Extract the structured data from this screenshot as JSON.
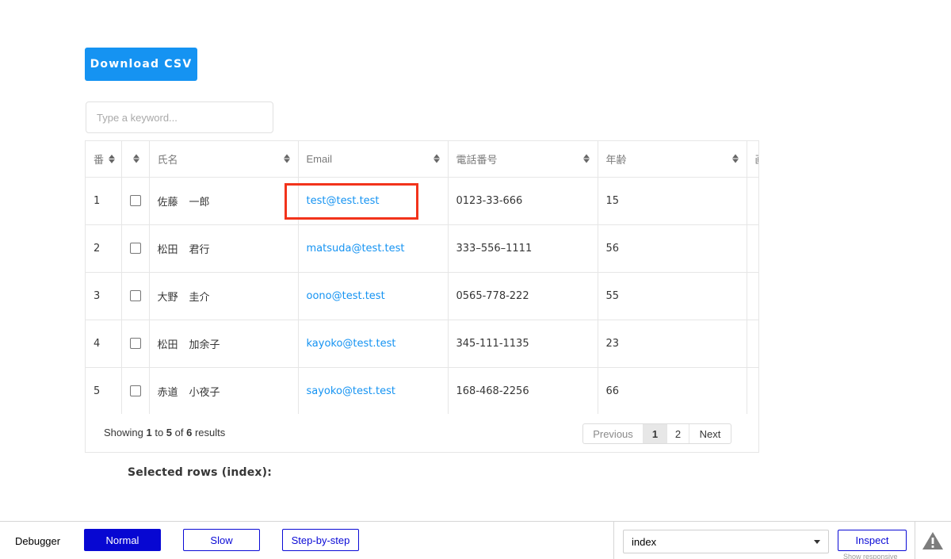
{
  "toolbar": {
    "download_label": "Download CSV"
  },
  "search": {
    "placeholder": "Type a keyword..."
  },
  "table": {
    "headers": {
      "index": "番",
      "checkbox": "",
      "name": "氏名",
      "email": "Email",
      "phone": "電話番号",
      "age": "年齢",
      "cut": "画"
    },
    "rows": [
      {
        "index": "1",
        "last": "佐藤",
        "first": "一郎",
        "email": "test@test.test",
        "phone": "0123-33-666",
        "age": "15"
      },
      {
        "index": "2",
        "last": "松田",
        "first": "君行",
        "email": "matsuda@test.test",
        "phone": "333–556–1111",
        "age": "56"
      },
      {
        "index": "3",
        "last": "大野",
        "first": "圭介",
        "email": "oono@test.test",
        "phone": "0565-778-222",
        "age": "55"
      },
      {
        "index": "4",
        "last": "松田",
        "first": "加余子",
        "email": "kayoko@test.test",
        "phone": "345-111-1135",
        "age": "23"
      },
      {
        "index": "5",
        "last": "赤道",
        "first": "小夜子",
        "email": "sayoko@test.test",
        "phone": "168-468-2256",
        "age": "66"
      }
    ],
    "image_peek_colors": [
      "#e8a87c",
      "#e8b07c",
      "#d9826a",
      "#b36a4f",
      "#c4846a"
    ]
  },
  "footer": {
    "showing_prefix": "Showing ",
    "from": "1",
    "to_word": " to ",
    "to": "5",
    "of_word": " of ",
    "total": "6",
    "results_word": " results",
    "pager": {
      "previous": "Previous",
      "page1": "1",
      "page2": "2",
      "next": "Next"
    }
  },
  "selected_rows_label": "Selected rows (index):",
  "debugger": {
    "label": "Debugger",
    "modes": [
      "Normal",
      "Slow",
      "Step-by-step"
    ],
    "active_mode": "Normal",
    "select_value": "index",
    "inspect_label": "Inspect",
    "show_responsive": "Show responsive"
  },
  "colors": {
    "accent": "#1593f2",
    "highlight": "#f2331b",
    "debugger_blue": "#0707d2"
  }
}
